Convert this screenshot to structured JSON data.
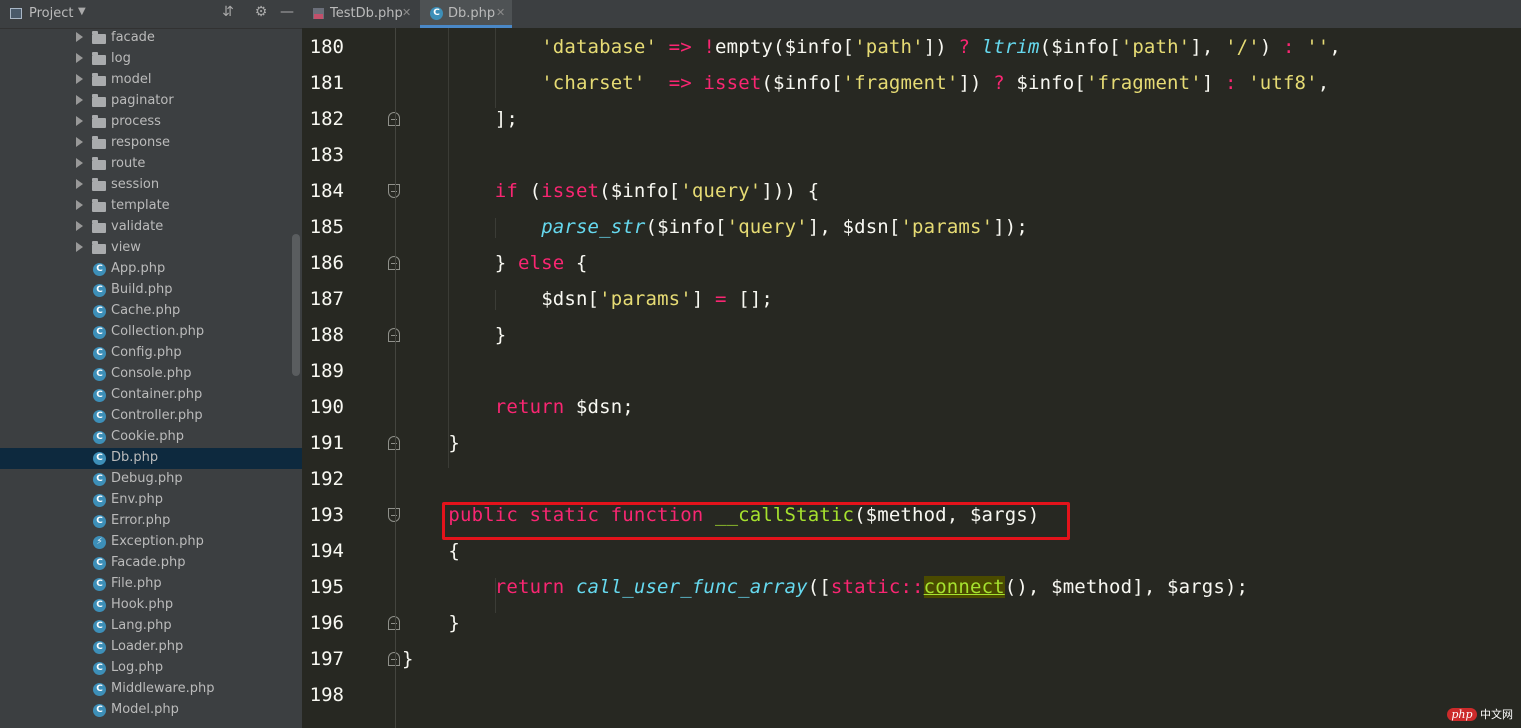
{
  "project_panel": {
    "title": "Project",
    "items": [
      {
        "label": "facade",
        "type": "folder"
      },
      {
        "label": "log",
        "type": "folder"
      },
      {
        "label": "model",
        "type": "folder"
      },
      {
        "label": "paginator",
        "type": "folder"
      },
      {
        "label": "process",
        "type": "folder"
      },
      {
        "label": "response",
        "type": "folder"
      },
      {
        "label": "route",
        "type": "folder"
      },
      {
        "label": "session",
        "type": "folder"
      },
      {
        "label": "template",
        "type": "folder"
      },
      {
        "label": "validate",
        "type": "folder"
      },
      {
        "label": "view",
        "type": "folder"
      },
      {
        "label": "App.php",
        "type": "class"
      },
      {
        "label": "Build.php",
        "type": "class"
      },
      {
        "label": "Cache.php",
        "type": "class"
      },
      {
        "label": "Collection.php",
        "type": "class"
      },
      {
        "label": "Config.php",
        "type": "class"
      },
      {
        "label": "Console.php",
        "type": "class"
      },
      {
        "label": "Container.php",
        "type": "class"
      },
      {
        "label": "Controller.php",
        "type": "class"
      },
      {
        "label": "Cookie.php",
        "type": "class"
      },
      {
        "label": "Db.php",
        "type": "class",
        "selected": true
      },
      {
        "label": "Debug.php",
        "type": "class"
      },
      {
        "label": "Env.php",
        "type": "class"
      },
      {
        "label": "Error.php",
        "type": "class"
      },
      {
        "label": "Exception.php",
        "type": "exception"
      },
      {
        "label": "Facade.php",
        "type": "class"
      },
      {
        "label": "File.php",
        "type": "class"
      },
      {
        "label": "Hook.php",
        "type": "class"
      },
      {
        "label": "Lang.php",
        "type": "class"
      },
      {
        "label": "Loader.php",
        "type": "class"
      },
      {
        "label": "Log.php",
        "type": "class"
      },
      {
        "label": "Middleware.php",
        "type": "class"
      },
      {
        "label": "Model.php",
        "type": "class"
      }
    ]
  },
  "tabs": [
    {
      "label": "TestDb.php",
      "active": false
    },
    {
      "label": "Db.php",
      "active": true
    }
  ],
  "editor": {
    "lines": [
      {
        "n": "180",
        "indent": 12,
        "tokens": [
          [
            "str",
            "'database'"
          ],
          [
            "plain",
            " "
          ],
          [
            "kw",
            "=>"
          ],
          [
            "plain",
            " "
          ],
          [
            "kw",
            "!"
          ],
          [
            "plain",
            "empty("
          ],
          [
            "plain",
            "$info["
          ],
          [
            "str",
            "'path'"
          ],
          [
            "plain",
            "]) "
          ],
          [
            "kw",
            "?"
          ],
          [
            "plain",
            " "
          ],
          [
            "fn-it",
            "ltrim"
          ],
          [
            "plain",
            "($info["
          ],
          [
            "str",
            "'path'"
          ],
          [
            "plain",
            "], "
          ],
          [
            "str",
            "'/'"
          ],
          [
            "plain",
            ") "
          ],
          [
            "kw",
            ":"
          ],
          [
            "plain",
            " "
          ],
          [
            "str",
            "''"
          ],
          [
            "plain",
            ","
          ]
        ]
      },
      {
        "n": "181",
        "indent": 12,
        "tokens": [
          [
            "str",
            "'charset'"
          ],
          [
            "plain",
            "  "
          ],
          [
            "kw",
            "=>"
          ],
          [
            "plain",
            " "
          ],
          [
            "kw",
            "isset"
          ],
          [
            "plain",
            "($info["
          ],
          [
            "str",
            "'fragment'"
          ],
          [
            "plain",
            "]) "
          ],
          [
            "kw",
            "?"
          ],
          [
            "plain",
            " $info["
          ],
          [
            "str",
            "'fragment'"
          ],
          [
            "plain",
            "] "
          ],
          [
            "kw",
            ":"
          ],
          [
            "plain",
            " "
          ],
          [
            "str",
            "'utf8'"
          ],
          [
            "plain",
            ","
          ]
        ]
      },
      {
        "n": "182",
        "indent": 8,
        "tokens": [
          [
            "plain",
            "];"
          ]
        ]
      },
      {
        "n": "183",
        "indent": 0,
        "tokens": []
      },
      {
        "n": "184",
        "indent": 8,
        "tokens": [
          [
            "kw",
            "if"
          ],
          [
            "plain",
            " ("
          ],
          [
            "kw",
            "isset"
          ],
          [
            "plain",
            "($info["
          ],
          [
            "str",
            "'query'"
          ],
          [
            "plain",
            "])) {"
          ]
        ]
      },
      {
        "n": "185",
        "indent": 12,
        "tokens": [
          [
            "fn-it",
            "parse_str"
          ],
          [
            "plain",
            "($info["
          ],
          [
            "str",
            "'query'"
          ],
          [
            "plain",
            "], $dsn["
          ],
          [
            "str",
            "'params'"
          ],
          [
            "plain",
            "]);"
          ]
        ]
      },
      {
        "n": "186",
        "indent": 8,
        "tokens": [
          [
            "plain",
            "} "
          ],
          [
            "kw",
            "else"
          ],
          [
            "plain",
            " {"
          ]
        ]
      },
      {
        "n": "187",
        "indent": 12,
        "tokens": [
          [
            "plain",
            "$dsn["
          ],
          [
            "str",
            "'params'"
          ],
          [
            "plain",
            "] "
          ],
          [
            "kw",
            "="
          ],
          [
            "plain",
            " [];"
          ]
        ]
      },
      {
        "n": "188",
        "indent": 8,
        "tokens": [
          [
            "plain",
            "}"
          ]
        ]
      },
      {
        "n": "189",
        "indent": 0,
        "tokens": []
      },
      {
        "n": "190",
        "indent": 8,
        "tokens": [
          [
            "kw",
            "return"
          ],
          [
            "plain",
            " $dsn;"
          ]
        ]
      },
      {
        "n": "191",
        "indent": 4,
        "tokens": [
          [
            "plain",
            "}"
          ]
        ]
      },
      {
        "n": "192",
        "indent": 0,
        "tokens": []
      },
      {
        "n": "193",
        "indent": 4,
        "tokens": [
          [
            "kw",
            "public"
          ],
          [
            "plain",
            " "
          ],
          [
            "kw",
            "static"
          ],
          [
            "plain",
            " "
          ],
          [
            "kw",
            "function"
          ],
          [
            "plain",
            " "
          ],
          [
            "fn-name",
            "__callStatic"
          ],
          [
            "plain",
            "($method, $args)"
          ]
        ]
      },
      {
        "n": "194",
        "indent": 4,
        "tokens": [
          [
            "plain",
            "{"
          ]
        ]
      },
      {
        "n": "195",
        "indent": 8,
        "tokens": [
          [
            "kw",
            "return"
          ],
          [
            "plain",
            " "
          ],
          [
            "fn-it",
            "call_user_func_array"
          ],
          [
            "plain",
            "(["
          ],
          [
            "kw",
            "static::"
          ],
          [
            "hl",
            "connect"
          ],
          [
            "plain",
            "(), $method], $args);"
          ]
        ]
      },
      {
        "n": "196",
        "indent": 4,
        "tokens": [
          [
            "plain",
            "}"
          ]
        ]
      },
      {
        "n": "197",
        "indent": 0,
        "tokens": [
          [
            "plain",
            "}"
          ]
        ]
      },
      {
        "n": "198",
        "indent": 0,
        "tokens": []
      }
    ]
  },
  "watermark": {
    "badge": "php",
    "text": "中文网"
  },
  "colors": {
    "keyword": "#f92672",
    "string": "#e6db74",
    "function": "#66d9ef",
    "name": "#a6e22e",
    "highlight_box": "#e3131b"
  }
}
